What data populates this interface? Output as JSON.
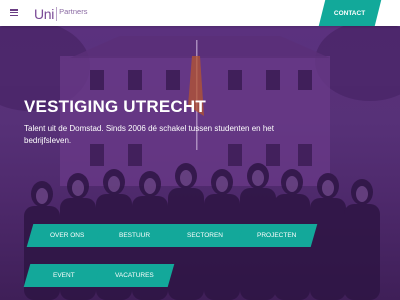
{
  "header": {
    "logo_uni": "Uni",
    "logo_partners": "Partners",
    "contact_label": "CONTACT"
  },
  "hero": {
    "title": "VESTIGING UTRECHT",
    "subtitle": "Talent uit de Domstad. Sinds 2006 dé schakel tussen studenten en het bedrijfsleven."
  },
  "nav_buttons": [
    {
      "label": "OVER ONS"
    },
    {
      "label": "BESTUUR"
    },
    {
      "label": "SECTOREN"
    },
    {
      "label": "PROJECTEN"
    },
    {
      "label": "EVENT"
    },
    {
      "label": "VACATURES"
    }
  ],
  "colors": {
    "accent": "#13a89a",
    "brand": "#7a4a96",
    "overlay": "#5a2f7a"
  },
  "icons": {
    "menu": "hamburger-icon"
  }
}
